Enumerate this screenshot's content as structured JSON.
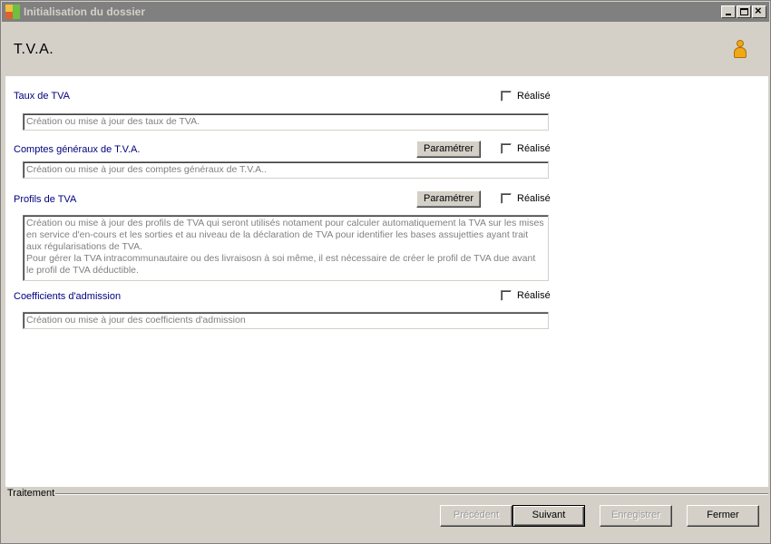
{
  "window": {
    "title": "Initialisation du dossier",
    "controls": {
      "minimize_icon": "minimize-icon",
      "maximize_icon": "maximize-icon",
      "close_icon": "close-icon"
    }
  },
  "header": {
    "title": "T.V.A.",
    "user_icon": "user-icon"
  },
  "sections": [
    {
      "label": "Taux de TVA",
      "realise_label": "Réalisé",
      "realise_checked": false,
      "description": "Création ou mise à jour des taux de TVA."
    },
    {
      "label": "Comptes généraux de T.V.A.",
      "button_label": "Paramétrer",
      "realise_label": "Réalisé",
      "realise_checked": false,
      "description": "Création ou mise à jour des comptes généraux de T.V.A.."
    },
    {
      "label": "Profils de TVA",
      "button_label": "Paramétrer",
      "realise_label": "Réalisé",
      "realise_checked": false,
      "description": "Création ou mise à jour des profils de TVA qui seront utilisés notament pour calculer automatiquement la TVA sur les mises en service d'en-cours et les sorties et au niveau de la déclaration de TVA pour identifier les bases assujetties ayant trait aux régularisations de TVA.\nPour gérer la TVA intracommunautaire ou des livraisosn à soi même, il est nécessaire de créer le profil de TVA due avant le profil de TVA déductible."
    },
    {
      "label": "Coefficients d'admission",
      "realise_label": "Réalisé",
      "realise_checked": false,
      "description": "Création ou mise à jour des coefficients d'admission"
    }
  ],
  "footer": {
    "group_label": "Traitement",
    "buttons": {
      "previous": "Précédent",
      "next": "Suivant",
      "save": "Enregistrer",
      "close": "Fermer"
    }
  }
}
